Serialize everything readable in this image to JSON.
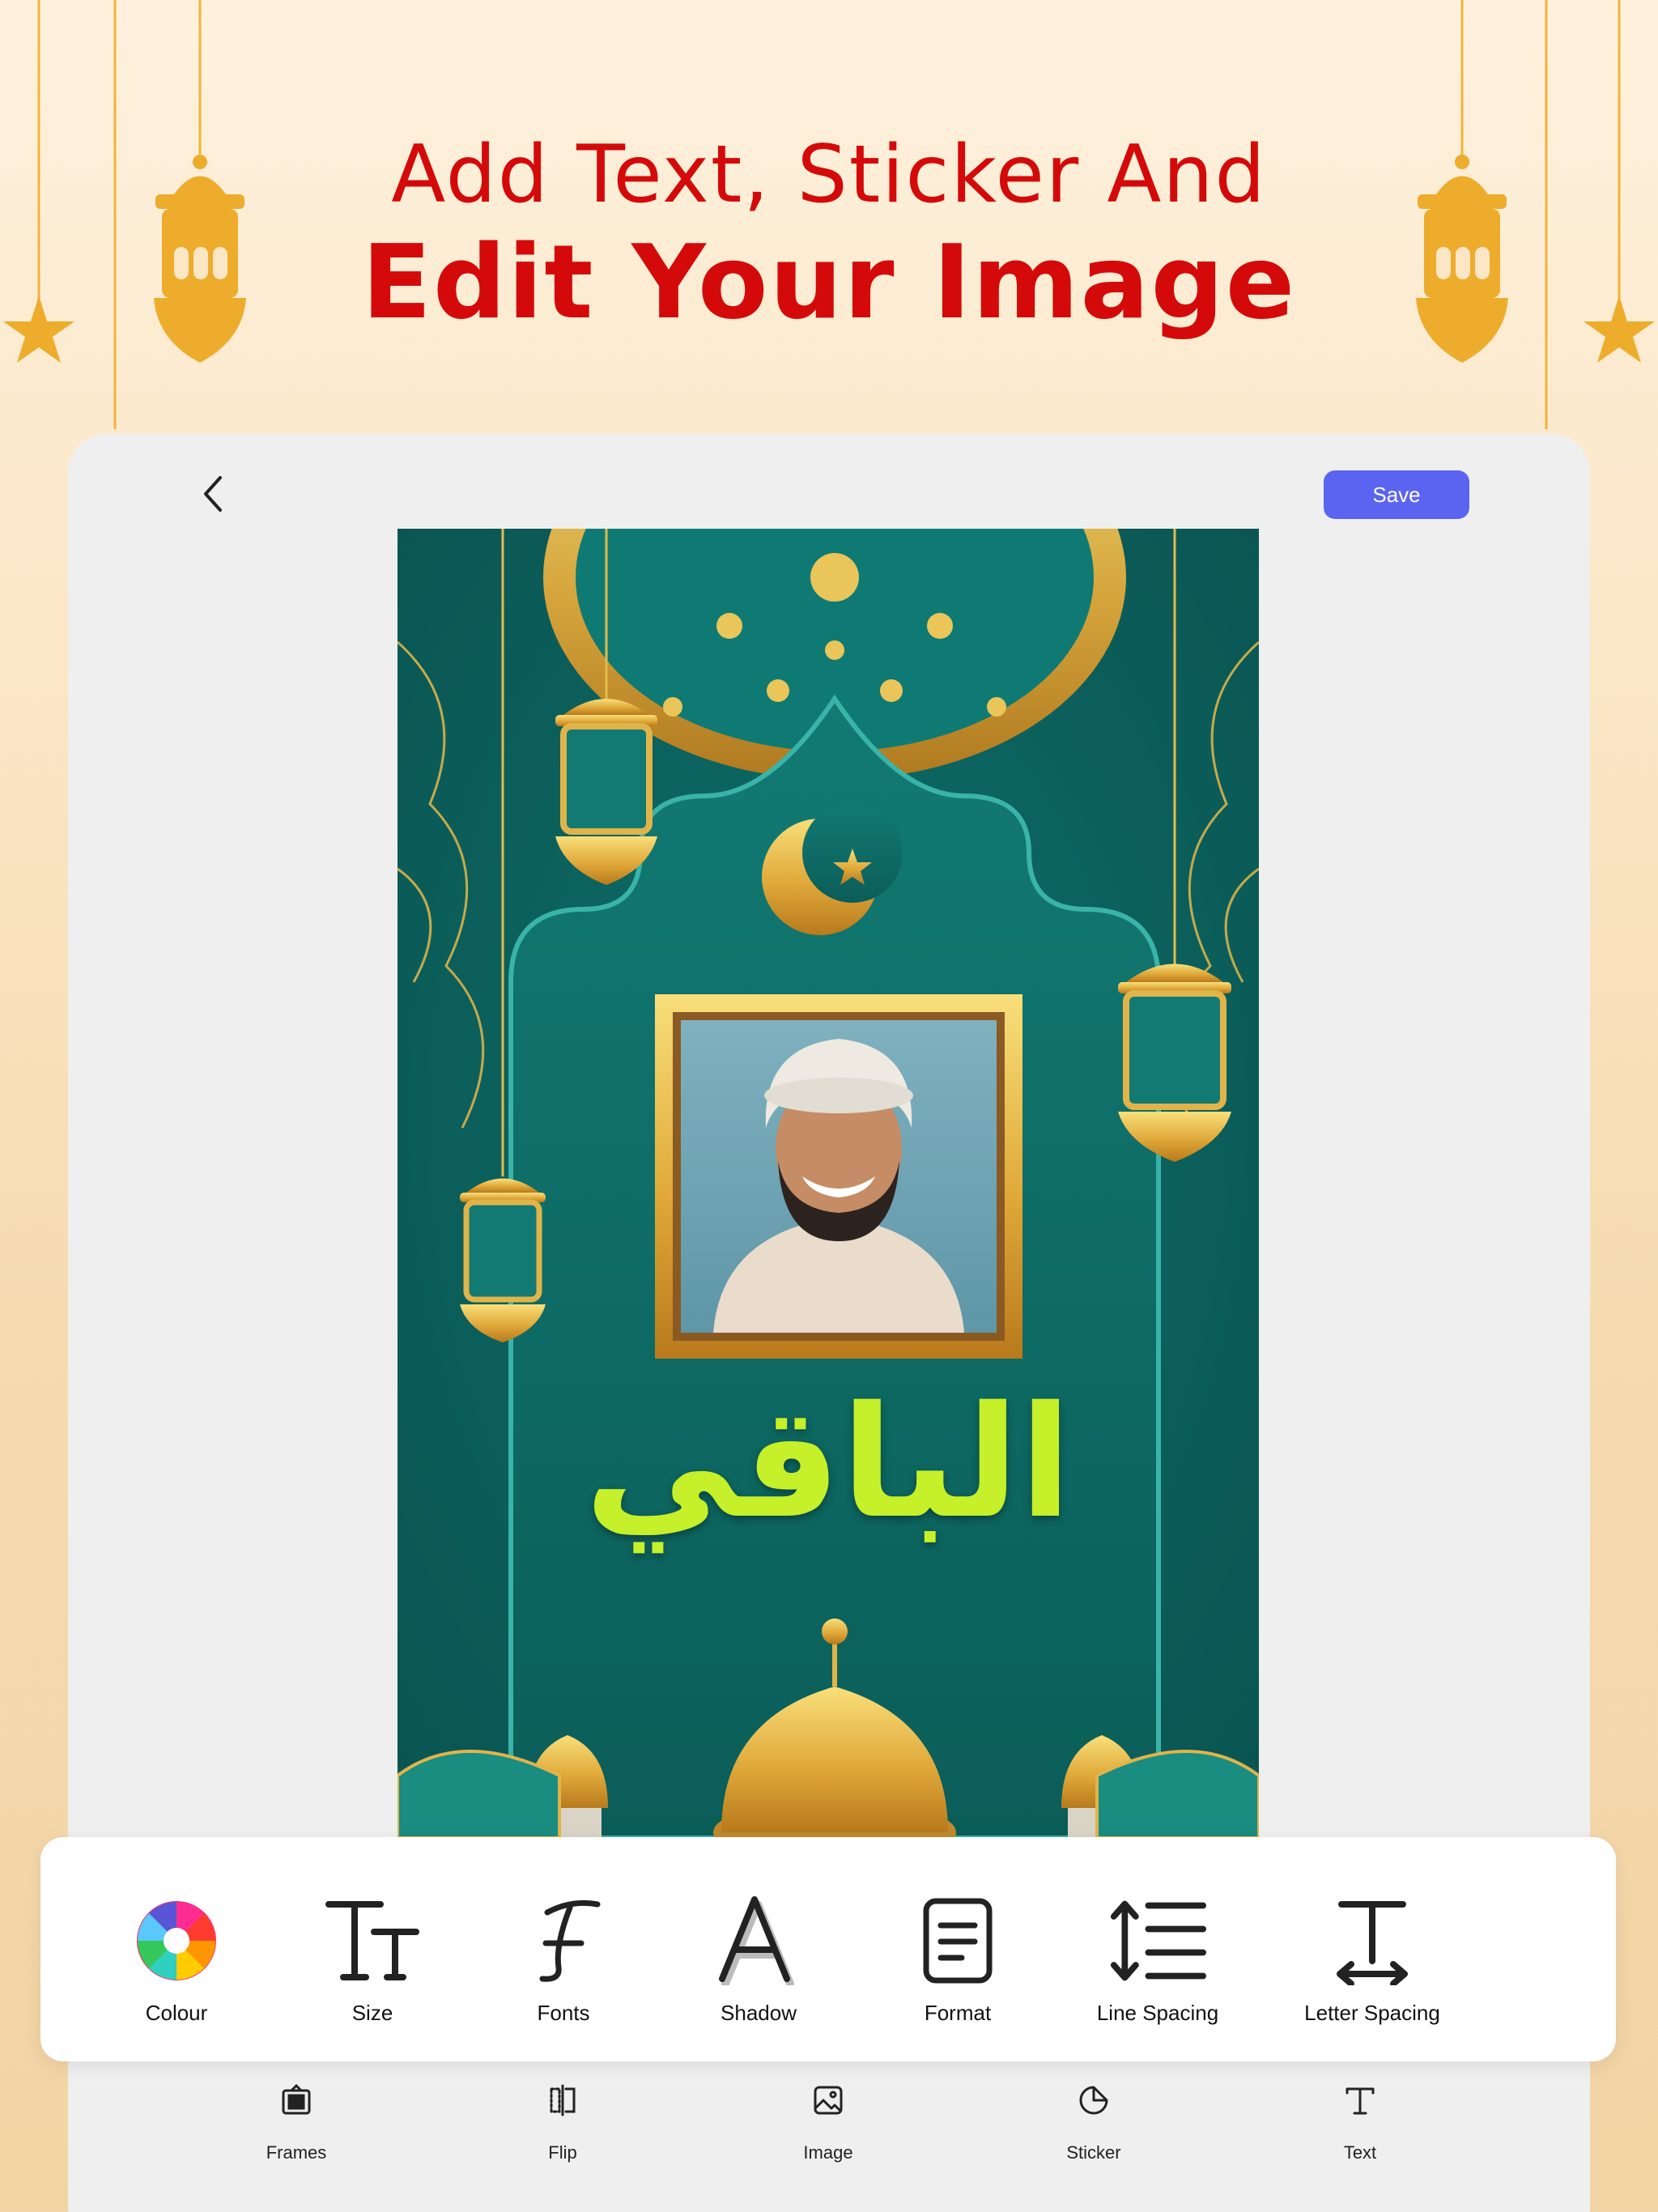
{
  "headline": {
    "line1": "Add Text, Sticker And",
    "line2": "Edit Your Image"
  },
  "topbar": {
    "back_icon": "chevron-left-icon",
    "save_label": "Save"
  },
  "canvas": {
    "arabic_text": "الباقي",
    "text_color": "#c5f02a",
    "background_color": "#0d6d68"
  },
  "toolbar": {
    "items": [
      {
        "label": "Colour",
        "icon": "color-wheel-icon"
      },
      {
        "label": "Size",
        "icon": "text-size-icon"
      },
      {
        "label": "Fonts",
        "icon": "font-icon"
      },
      {
        "label": "Shadow",
        "icon": "text-shadow-icon"
      },
      {
        "label": "Format",
        "icon": "format-icon"
      },
      {
        "label": "Line Spacing",
        "icon": "line-spacing-icon"
      },
      {
        "label": "Letter Spacing",
        "icon": "letter-spacing-icon"
      }
    ]
  },
  "bottom_nav": {
    "items": [
      {
        "label": "Frames",
        "icon": "frames-icon"
      },
      {
        "label": "Flip",
        "icon": "flip-icon"
      },
      {
        "label": "Image",
        "icon": "image-icon"
      },
      {
        "label": "Sticker",
        "icon": "sticker-icon"
      },
      {
        "label": "Text",
        "icon": "text-icon"
      }
    ]
  },
  "colors": {
    "accent": "#5b63f1",
    "headline": "#d40a0a",
    "gold": "#eeac2c"
  }
}
